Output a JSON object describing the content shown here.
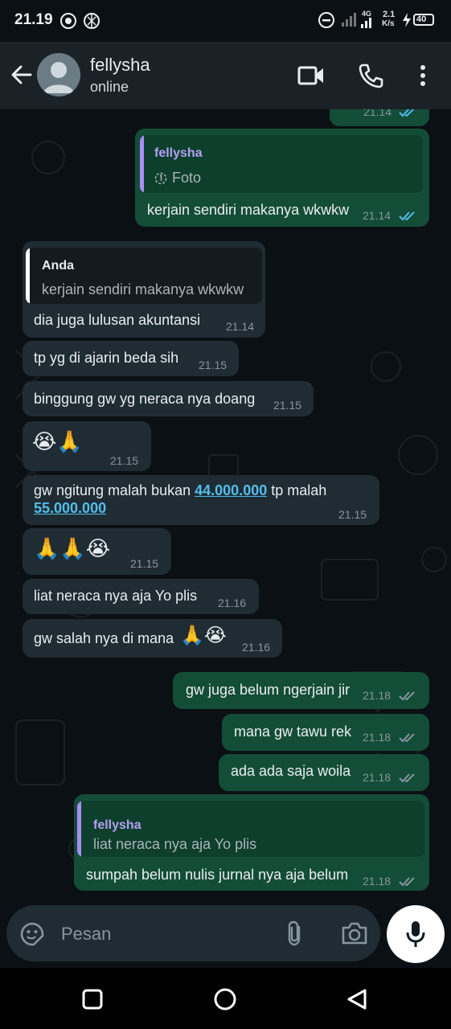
{
  "status_bar": {
    "time": "21.19",
    "network_type": "4G",
    "data_speed_value": "2.1",
    "data_speed_unit": "K/s",
    "battery_level": "40"
  },
  "header": {
    "contact_name": "fellysha",
    "status": "online",
    "icons": [
      "arrow-back-icon",
      "avatar",
      "video-call-icon",
      "voice-call-icon",
      "more-vert-icon"
    ]
  },
  "messages": [
    {
      "dir": "out",
      "time": "21.14",
      "read": true,
      "partial": true
    },
    {
      "dir": "out",
      "quote_author": "fellysha",
      "quote_text": "Foto",
      "quote_icon": "view-once-icon",
      "text": "kerjain sendiri makanya wkwkw",
      "time": "21.14",
      "read": true
    },
    {
      "dir": "in",
      "quote_author": "Anda",
      "quote_text": "kerjain sendiri makanya wkwkw",
      "text": "dia juga lulusan akuntansi",
      "time": "21.14"
    },
    {
      "dir": "in",
      "text": "tp yg di ajarin beda sih",
      "time": "21.15"
    },
    {
      "dir": "in",
      "text": "binggung gw yg neraca nya doang",
      "time": "21.15"
    },
    {
      "dir": "in",
      "text": "😭🙏",
      "time": "21.15"
    },
    {
      "dir": "in",
      "text_before": "gw ngitung malah bukan ",
      "link1": "44.000.000",
      "text_mid": " tp malah",
      "link2": "55.000.000",
      "time": "21.15"
    },
    {
      "dir": "in",
      "text": "🙏🙏😭",
      "time": "21.15"
    },
    {
      "dir": "in",
      "text": "liat neraca nya aja Yo plis",
      "time": "21.16"
    },
    {
      "dir": "in",
      "text": "gw salah nya di mana",
      "emoji": "🙏😭",
      "time": "21.16"
    },
    {
      "dir": "out",
      "text": "gw juga belum ngerjain jir",
      "time": "21.18",
      "read": false
    },
    {
      "dir": "out",
      "text": "mana gw tawu rek",
      "time": "21.18",
      "read": false
    },
    {
      "dir": "out",
      "text": "ada ada saja woila",
      "time": "21.18",
      "read": false
    },
    {
      "dir": "out",
      "quote_author": "fellysha",
      "quote_text": "liat neraca nya aja Yo plis",
      "text": "sumpah belum nulis jurnal nya aja belum",
      "time": "21.18",
      "read": false
    }
  ],
  "composer": {
    "placeholder": "Pesan",
    "icons": [
      "emoji-sticker-icon",
      "attach-icon",
      "camera-icon",
      "mic-icon"
    ]
  },
  "nav_bar": {
    "icons": [
      "recents-square-icon",
      "home-circle-icon",
      "back-triangle-icon"
    ]
  },
  "colors": {
    "app_bar": "#1a2228",
    "background": "#0b1014",
    "incoming_bubble": "#1f2c33",
    "outgoing_bubble": "#134d37",
    "read_tick": "#53bdeb",
    "unread_tick": "#8696a0",
    "quote_bar_contact": "#a98ef5",
    "quote_bar_self": "#ffffff",
    "link": "#53bdeb"
  }
}
